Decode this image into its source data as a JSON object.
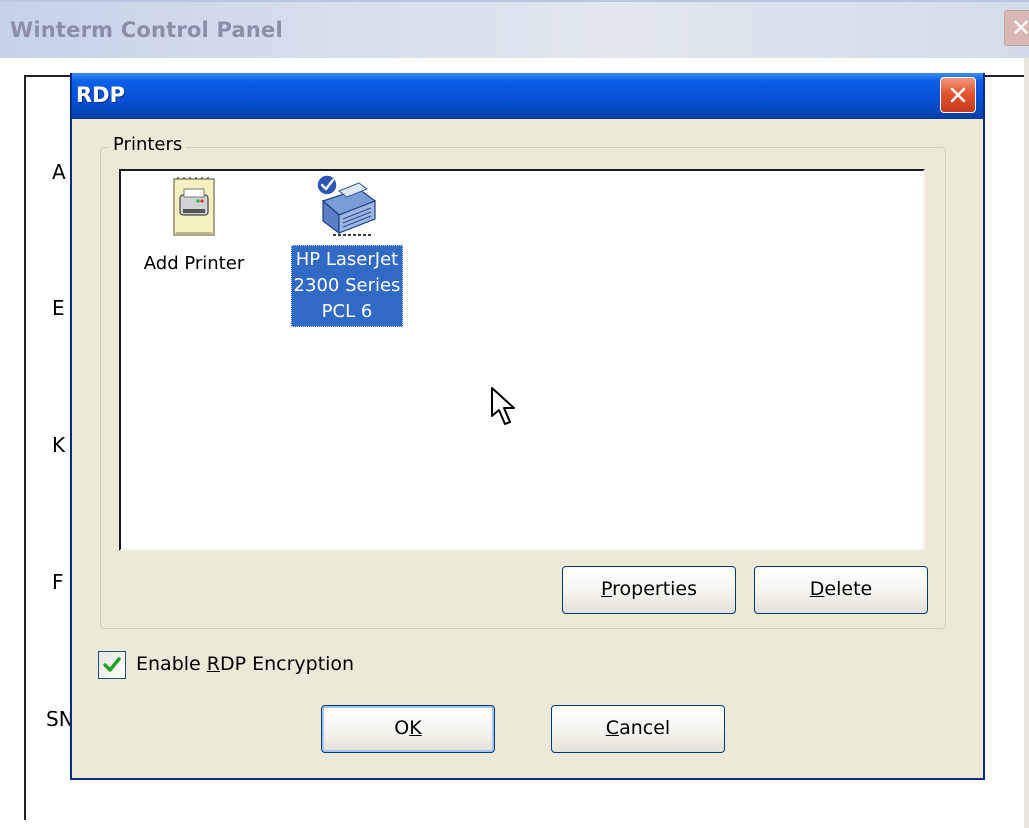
{
  "background_window": {
    "title": "Winterm Control Panel",
    "partial_labels": [
      "A",
      "E",
      "K",
      "F",
      "SN"
    ]
  },
  "dialog": {
    "title": "RDP",
    "printers_group": {
      "label": "Printers",
      "items": [
        {
          "label": "Add Printer",
          "icon": "add-printer-icon",
          "selected": false
        },
        {
          "label": "HP LaserJet\n2300 Series\nPCL 6",
          "icon": "default-printer-icon",
          "selected": true
        }
      ]
    },
    "buttons": {
      "properties": {
        "prefix": "",
        "accel": "P",
        "rest": "roperties"
      },
      "delete": {
        "prefix": "",
        "accel": "D",
        "rest": "elete"
      },
      "ok": {
        "prefix": "O",
        "accel": "K",
        "rest": ""
      },
      "cancel": {
        "prefix": "",
        "accel": "C",
        "rest": "ancel"
      }
    },
    "encryption": {
      "checked": true,
      "prefix": "Enable ",
      "accel": "R",
      "rest": "DP Encryption"
    }
  },
  "colors": {
    "title_blue": "#0553d9",
    "selection_blue": "#316ac5",
    "dialog_face": "#ece9d8",
    "close_red": "#e2552f",
    "check_green": "#21a121"
  }
}
